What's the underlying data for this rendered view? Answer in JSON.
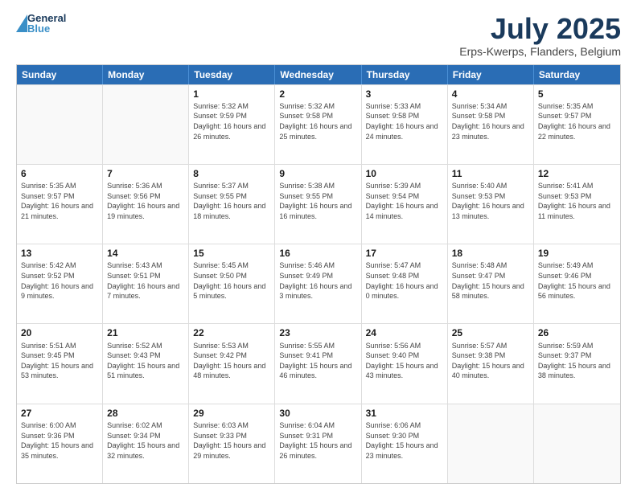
{
  "header": {
    "logo_general": "General",
    "logo_blue": "Blue",
    "title": "July 2025",
    "subtitle": "Erps-Kwerps, Flanders, Belgium"
  },
  "days_of_week": [
    "Sunday",
    "Monday",
    "Tuesday",
    "Wednesday",
    "Thursday",
    "Friday",
    "Saturday"
  ],
  "weeks": [
    [
      {
        "day": "",
        "text": ""
      },
      {
        "day": "",
        "text": ""
      },
      {
        "day": "1",
        "text": "Sunrise: 5:32 AM\nSunset: 9:59 PM\nDaylight: 16 hours and 26 minutes."
      },
      {
        "day": "2",
        "text": "Sunrise: 5:32 AM\nSunset: 9:58 PM\nDaylight: 16 hours and 25 minutes."
      },
      {
        "day": "3",
        "text": "Sunrise: 5:33 AM\nSunset: 9:58 PM\nDaylight: 16 hours and 24 minutes."
      },
      {
        "day": "4",
        "text": "Sunrise: 5:34 AM\nSunset: 9:58 PM\nDaylight: 16 hours and 23 minutes."
      },
      {
        "day": "5",
        "text": "Sunrise: 5:35 AM\nSunset: 9:57 PM\nDaylight: 16 hours and 22 minutes."
      }
    ],
    [
      {
        "day": "6",
        "text": "Sunrise: 5:35 AM\nSunset: 9:57 PM\nDaylight: 16 hours and 21 minutes."
      },
      {
        "day": "7",
        "text": "Sunrise: 5:36 AM\nSunset: 9:56 PM\nDaylight: 16 hours and 19 minutes."
      },
      {
        "day": "8",
        "text": "Sunrise: 5:37 AM\nSunset: 9:55 PM\nDaylight: 16 hours and 18 minutes."
      },
      {
        "day": "9",
        "text": "Sunrise: 5:38 AM\nSunset: 9:55 PM\nDaylight: 16 hours and 16 minutes."
      },
      {
        "day": "10",
        "text": "Sunrise: 5:39 AM\nSunset: 9:54 PM\nDaylight: 16 hours and 14 minutes."
      },
      {
        "day": "11",
        "text": "Sunrise: 5:40 AM\nSunset: 9:53 PM\nDaylight: 16 hours and 13 minutes."
      },
      {
        "day": "12",
        "text": "Sunrise: 5:41 AM\nSunset: 9:53 PM\nDaylight: 16 hours and 11 minutes."
      }
    ],
    [
      {
        "day": "13",
        "text": "Sunrise: 5:42 AM\nSunset: 9:52 PM\nDaylight: 16 hours and 9 minutes."
      },
      {
        "day": "14",
        "text": "Sunrise: 5:43 AM\nSunset: 9:51 PM\nDaylight: 16 hours and 7 minutes."
      },
      {
        "day": "15",
        "text": "Sunrise: 5:45 AM\nSunset: 9:50 PM\nDaylight: 16 hours and 5 minutes."
      },
      {
        "day": "16",
        "text": "Sunrise: 5:46 AM\nSunset: 9:49 PM\nDaylight: 16 hours and 3 minutes."
      },
      {
        "day": "17",
        "text": "Sunrise: 5:47 AM\nSunset: 9:48 PM\nDaylight: 16 hours and 0 minutes."
      },
      {
        "day": "18",
        "text": "Sunrise: 5:48 AM\nSunset: 9:47 PM\nDaylight: 15 hours and 58 minutes."
      },
      {
        "day": "19",
        "text": "Sunrise: 5:49 AM\nSunset: 9:46 PM\nDaylight: 15 hours and 56 minutes."
      }
    ],
    [
      {
        "day": "20",
        "text": "Sunrise: 5:51 AM\nSunset: 9:45 PM\nDaylight: 15 hours and 53 minutes."
      },
      {
        "day": "21",
        "text": "Sunrise: 5:52 AM\nSunset: 9:43 PM\nDaylight: 15 hours and 51 minutes."
      },
      {
        "day": "22",
        "text": "Sunrise: 5:53 AM\nSunset: 9:42 PM\nDaylight: 15 hours and 48 minutes."
      },
      {
        "day": "23",
        "text": "Sunrise: 5:55 AM\nSunset: 9:41 PM\nDaylight: 15 hours and 46 minutes."
      },
      {
        "day": "24",
        "text": "Sunrise: 5:56 AM\nSunset: 9:40 PM\nDaylight: 15 hours and 43 minutes."
      },
      {
        "day": "25",
        "text": "Sunrise: 5:57 AM\nSunset: 9:38 PM\nDaylight: 15 hours and 40 minutes."
      },
      {
        "day": "26",
        "text": "Sunrise: 5:59 AM\nSunset: 9:37 PM\nDaylight: 15 hours and 38 minutes."
      }
    ],
    [
      {
        "day": "27",
        "text": "Sunrise: 6:00 AM\nSunset: 9:36 PM\nDaylight: 15 hours and 35 minutes."
      },
      {
        "day": "28",
        "text": "Sunrise: 6:02 AM\nSunset: 9:34 PM\nDaylight: 15 hours and 32 minutes."
      },
      {
        "day": "29",
        "text": "Sunrise: 6:03 AM\nSunset: 9:33 PM\nDaylight: 15 hours and 29 minutes."
      },
      {
        "day": "30",
        "text": "Sunrise: 6:04 AM\nSunset: 9:31 PM\nDaylight: 15 hours and 26 minutes."
      },
      {
        "day": "31",
        "text": "Sunrise: 6:06 AM\nSunset: 9:30 PM\nDaylight: 15 hours and 23 minutes."
      },
      {
        "day": "",
        "text": ""
      },
      {
        "day": "",
        "text": ""
      }
    ]
  ]
}
